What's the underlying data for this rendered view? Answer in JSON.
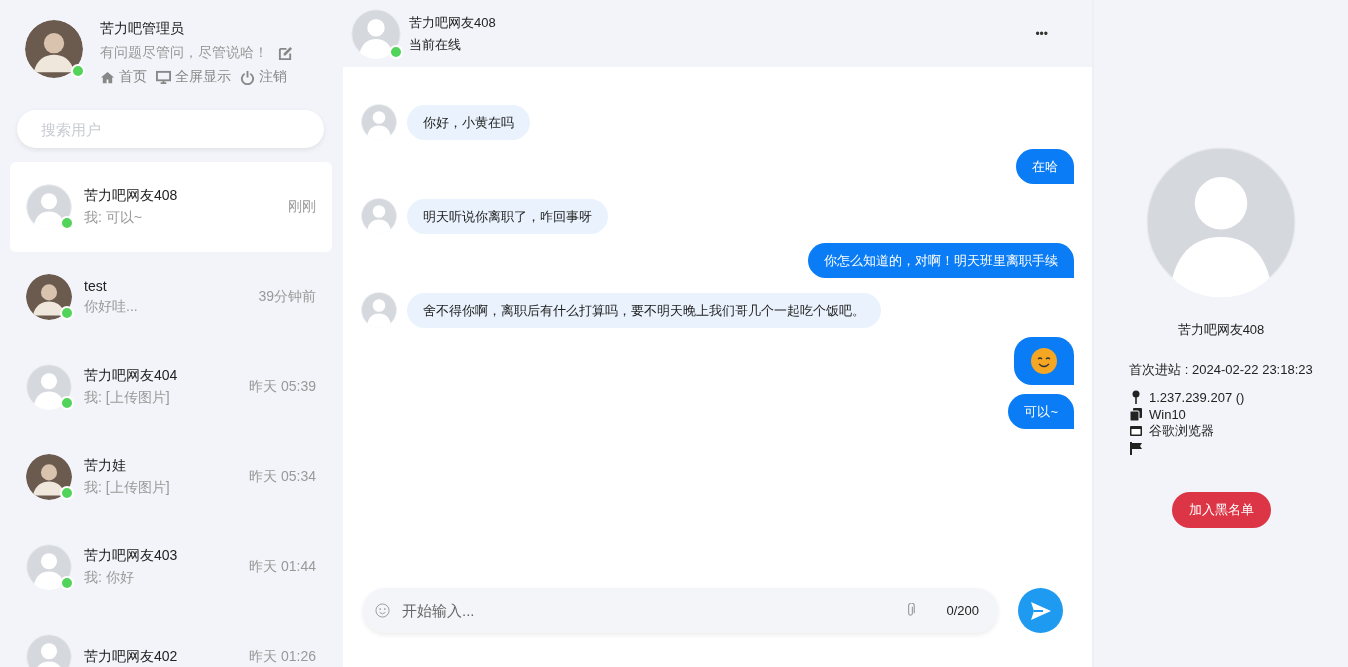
{
  "profile": {
    "name": "苦力吧管理员",
    "status_text": "有问题尽管问，尽管说哈！",
    "online": true,
    "links": [
      {
        "label": "首页"
      },
      {
        "label": "全屏显示"
      },
      {
        "label": "注销"
      }
    ]
  },
  "search": {
    "placeholder": "搜索用户"
  },
  "conversations": [
    {
      "name": "苦力吧网友408",
      "preview": "我: 可以~",
      "time": "刚刚",
      "kind": "default",
      "online": true,
      "selected": true
    },
    {
      "name": "test",
      "preview": "你好哇...",
      "time": "39分钟前",
      "kind": "photo",
      "online": true,
      "selected": false
    },
    {
      "name": "苦力吧网友404",
      "preview": "我: [上传图片]",
      "time": "昨天 05:39",
      "kind": "default",
      "online": true,
      "selected": false
    },
    {
      "name": "苦力娃",
      "preview": "我: [上传图片]",
      "time": "昨天 05:34",
      "kind": "photo",
      "online": true,
      "selected": false
    },
    {
      "name": "苦力吧网友403",
      "preview": "我: 你好",
      "time": "昨天 01:44",
      "kind": "default",
      "online": true,
      "selected": false
    },
    {
      "name": "苦力吧网友402",
      "time": "昨天 01:26",
      "kind": "default",
      "online": false,
      "selected": false
    }
  ],
  "chat_header": {
    "name": "苦力吧网友408",
    "status": "当前在线",
    "online": true,
    "menu": "•••"
  },
  "messages": [
    {
      "kind": "received",
      "text": "你好，小黄在吗"
    },
    {
      "kind": "sent",
      "text": "在哈"
    },
    {
      "kind": "received",
      "text": "明天听说你离职了，咋回事呀"
    },
    {
      "kind": "sent",
      "text": "你怎么知道的，对啊！明天班里离职手续"
    },
    {
      "kind": "received",
      "text": "舍不得你啊，离职后有什么打算吗，要不明天晚上我们哥几个一起吃个饭吧。"
    },
    {
      "kind": "sent_emoji"
    },
    {
      "kind": "sent",
      "text": "可以~"
    }
  ],
  "composer": {
    "placeholder": "开始输入...",
    "counter": "0/200"
  },
  "user_info": {
    "name": "苦力吧网友408",
    "first_visit": "首次进站 : 2024-02-22 23:18:23",
    "details": [
      {
        "kind": "location",
        "text": "1.237.239.207 ()"
      },
      {
        "kind": "device",
        "text": "Win10"
      },
      {
        "kind": "browser",
        "text": "谷歌浏览器"
      },
      {
        "kind": "flag"
      }
    ],
    "blacklist_button": "加入黑名单"
  }
}
